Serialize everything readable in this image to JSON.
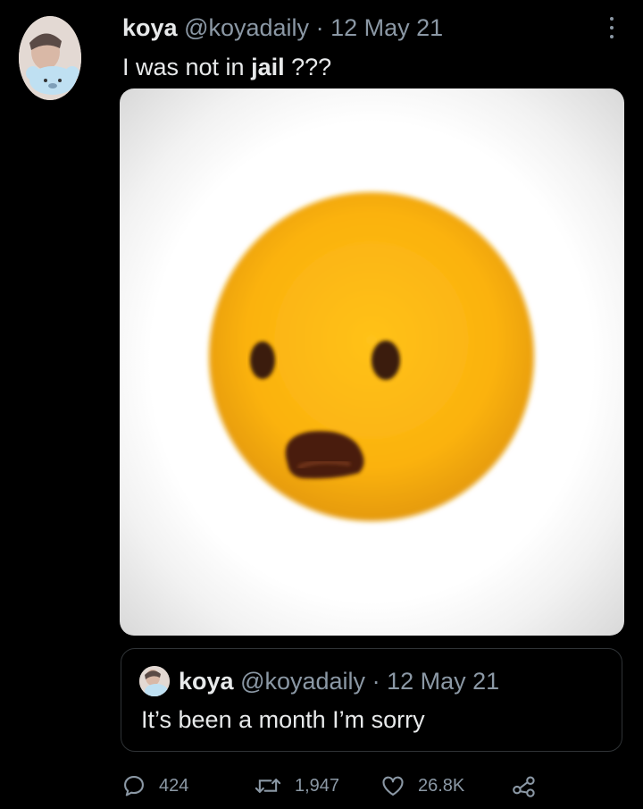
{
  "tweet": {
    "display_name": "koya",
    "handle": "@koyadaily",
    "separator": "·",
    "date": "12 May 21",
    "text_before": "I was not in ",
    "text_bold": "jail",
    "text_after": " ???"
  },
  "media": {
    "icon": "surprised-face-emoji"
  },
  "quoted_tweet": {
    "display_name": "koya",
    "handle": "@koyadaily",
    "separator": "·",
    "date": "12 May 21",
    "text": "It’s been a month I’m sorry"
  },
  "actions": {
    "replies": "424",
    "retweets": "1,947",
    "likes": "26.8K"
  },
  "colors": {
    "background": "#000000",
    "text": "#e7e9ea",
    "muted": "#8b98a5",
    "border": "#2f3336"
  }
}
